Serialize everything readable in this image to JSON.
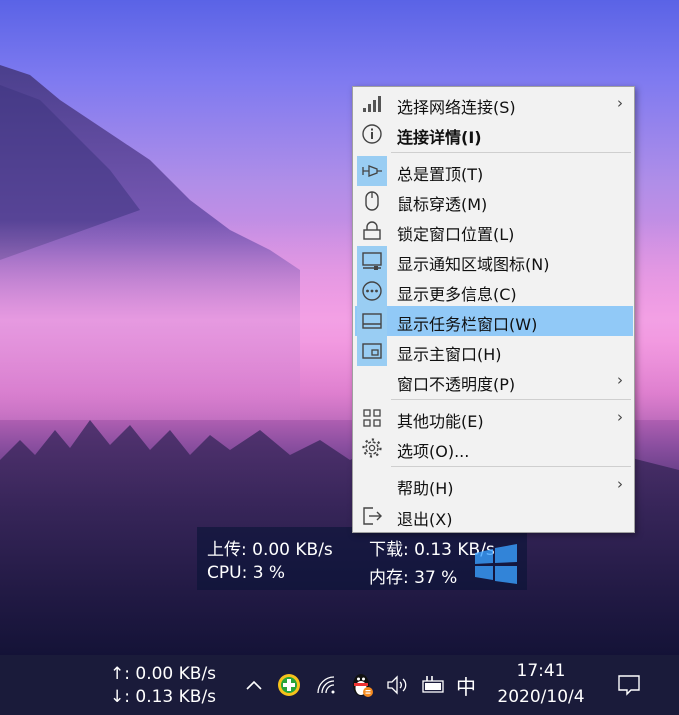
{
  "menu": {
    "items": [
      {
        "label": "选择网络连接(S)",
        "icon": "signal-bars-icon",
        "submenu": true
      },
      {
        "label": "连接详情(I)",
        "icon": "info-icon",
        "bold": true
      },
      {
        "label": "总是置顶(T)",
        "icon": "pin-icon",
        "checked": true
      },
      {
        "label": "鼠标穿透(M)",
        "icon": "mouse-icon"
      },
      {
        "label": "锁定窗口位置(L)",
        "icon": "lock-icon"
      },
      {
        "label": "显示通知区域图标(N)",
        "icon": "tray-monitor-icon",
        "checked": true
      },
      {
        "label": "显示更多信息(C)",
        "icon": "more-dots-icon",
        "checked": true
      },
      {
        "label": "显示任务栏窗口(W)",
        "icon": "taskbar-window-icon",
        "checked": true,
        "highlighted": true
      },
      {
        "label": "显示主窗口(H)",
        "icon": "main-window-icon",
        "checked": true
      },
      {
        "label": "窗口不透明度(P)",
        "icon": "",
        "submenu": true
      },
      {
        "label": "其他功能(E)",
        "icon": "grid-icon",
        "submenu": true
      },
      {
        "label": "选项(O)...",
        "icon": "gear-icon"
      },
      {
        "label": "帮助(H)",
        "icon": "",
        "submenu": true
      },
      {
        "label": "退出(X)",
        "icon": "exit-icon"
      }
    ],
    "submenu_arrow": ">"
  },
  "widget": {
    "upload": "上传: 0.00 KB/s",
    "download": "下载: 0.13 KB/s",
    "cpu": "CPU: 3 %",
    "memory": "内存: 37 %"
  },
  "taskbar": {
    "speed_up": "↑: 0.00 KB/s",
    "speed_down": "↓: 0.13 KB/s",
    "show_hidden": "^",
    "ime": "中",
    "time": "17:41",
    "date": "2020/10/4"
  },
  "colors": {
    "menu_bg": "#f2f2f2",
    "highlight": "#91c9f7",
    "checked_bg": "#99cdf3",
    "taskbar_bg": "#1a1b3a"
  }
}
